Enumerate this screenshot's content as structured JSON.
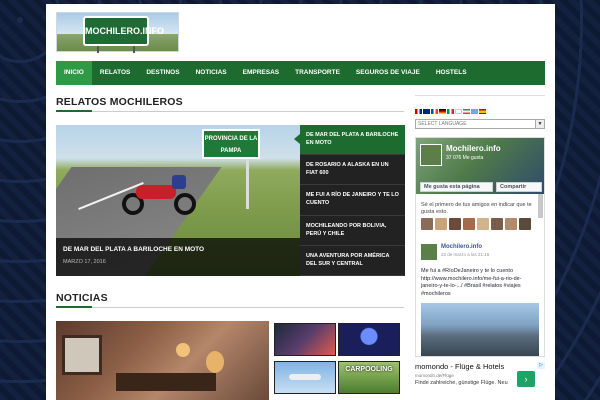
{
  "logo": {
    "text": "MOCHILERO.INFO"
  },
  "nav": {
    "items": [
      "INICIO",
      "RELATOS",
      "DESTINOS",
      "NOTICIAS",
      "EMPRESAS",
      "TRANSPORTE",
      "SEGUROS DE VIAJE",
      "HOSTELS"
    ],
    "active_index": 0
  },
  "relatos": {
    "section_title": "RELATOS MOCHILEROS",
    "sign_text": "PROVINCIA DE LA PAMPA",
    "featured": {
      "title": "DE MAR DEL PLATA A BARILOCHE EN MOTO",
      "date": "MARZO 17, 2016"
    },
    "list": [
      "DE MAR DEL PLATA A BARILOCHE EN MOTO",
      "DE ROSARIO A ALASKA EN UN FIAT 600",
      "ME FUI A RÍO DE JANEIRO Y TE LO CUENTO",
      "MOCHILEANDO POR BOLIVIA, PERÚ Y CHILE",
      "UNA AVENTURA POR AMÉRICA DEL SUR Y CENTRAL"
    ]
  },
  "noticias": {
    "section_title": "NOTICIAS",
    "carpooling_text": "CARPOOLING"
  },
  "sidebar": {
    "language_select": "SELECT LANGUAGE",
    "facebook": {
      "page_name": "Mochilero.info",
      "likes": "37 076 Me gusta",
      "like_button": "Me gusta esta página",
      "share_button": "Compartir",
      "friends_text": "Sé el primero de tus amigos en indicar que te gusta esto.",
      "post": {
        "author": "Mochilero.info",
        "date": "22 de marzo a las 21:16",
        "text": "Me fui a #RíoDeJaneiro y te lo cuento http://www.mochilero.info/me-fui-a-rio-de-janeiro-y-te-lo-.../ #Brasil #relatos #viajes #mochileros"
      }
    },
    "ad": {
      "title": "momondo - Flüge & Hotels",
      "source": "momondo.de/Flüge",
      "description": "Finde zahlreiche, günstige Flüge. Neu"
    }
  },
  "colors": {
    "brand_green": "#1d6b2e",
    "nav_active": "#2f9a45",
    "background": "#0e1a33"
  }
}
